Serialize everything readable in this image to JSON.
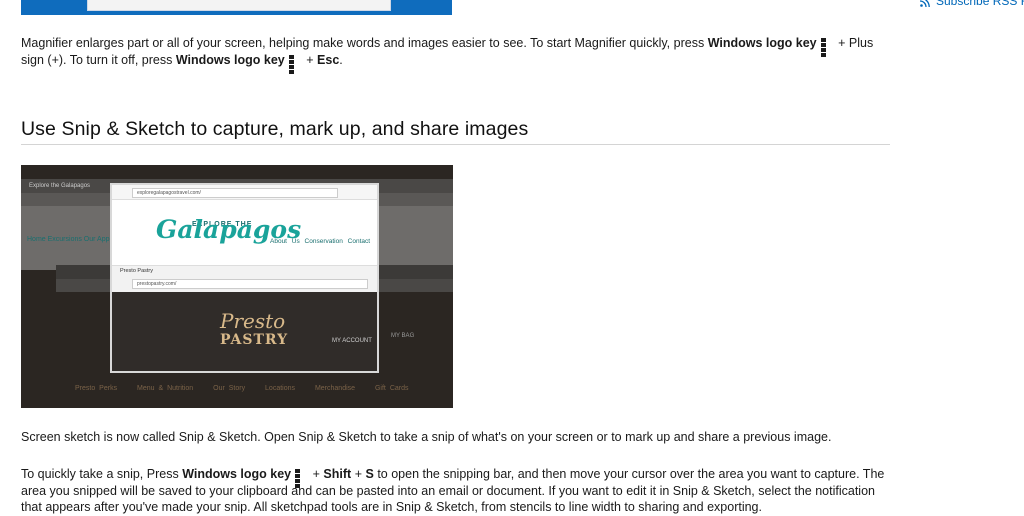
{
  "rss": {
    "label": "Subscribe RSS F"
  },
  "magnifier": {
    "intro": "Magnifier enlarges part or all of your screen, helping make words and images easier to see. To start Magnifier quickly, press",
    "key1": "Windows logo key",
    "plus_sign": "+ Plus sign (+). To turn it off, press",
    "key2": "Windows logo key",
    "esc_prefix": "+",
    "esc": "Esc",
    "end": "."
  },
  "section": {
    "heading": "Use Snip & Sketch to capture, mark up, and share images"
  },
  "screenshot": {
    "tab1": "Explore the Galapagos",
    "url1": "exploregalapagostravel.com/",
    "nav_left": "Home  Excursions  Our Approach",
    "logo_top": "EXPLORE THE",
    "logo_main": "Galapagos",
    "nav_right": "About Us  Conservation  Contact",
    "tab2": "Presto Pastry",
    "url2": "prestopastry.com/",
    "brand_script": "Presto",
    "brand_word": "PASTRY",
    "my_account": "MY ACCOUNT",
    "my_bag": "MY BAG",
    "bottom_nav": [
      "Presto Perks",
      "Menu & Nutrition",
      "Our Story",
      "Locations",
      "Merchandise",
      "Gift Cards"
    ]
  },
  "sketch": {
    "para1": "Screen sketch is now called Snip & Sketch. Open Snip & Sketch to take a snip of what's on your screen or to mark up and share a previous image.",
    "p2_a": "To quickly take a snip, Press",
    "p2_key": "Windows logo key",
    "p2_plus1": "+",
    "p2_shift": "Shift",
    "p2_plus2": "+",
    "p2_s": "S",
    "p2_b": "to open the snipping bar, and then move your cursor over the area you want to capture. The area you snipped will be saved to your clipboard and can be pasted into an email or document. If you want to edit it in Snip & Sketch, select the notification that appears after you've made your snip. All sketchpad tools are in Snip & Sketch, from stencils to line width to sharing and exporting."
  }
}
